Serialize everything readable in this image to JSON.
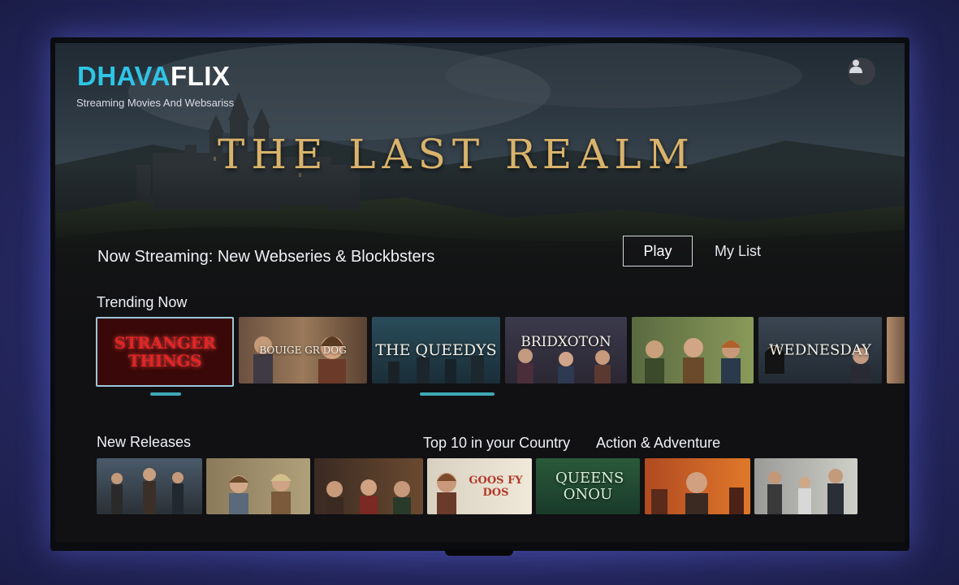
{
  "app": {
    "logo_part1": "DHAVA",
    "logo_part2": "FLIX",
    "tagline": "Streaming Movies And Websariss"
  },
  "hero": {
    "title": "THE LAST REALM",
    "subline": "Now Streaming: New Webseries & Blockbsters",
    "play_label": "Play",
    "mylist_label": "My List"
  },
  "colors": {
    "accent": "#2fc4e6",
    "title_gold": "#d9b36b",
    "indicator": "#3fa9b5"
  },
  "trending": {
    "heading": "Trending Now",
    "cards": [
      {
        "title": "STRANGER THINGS",
        "selected": true
      },
      {
        "title": "BOUIGE GR DOG",
        "selected": false
      },
      {
        "title": "THE QUEEDYS",
        "selected": false
      },
      {
        "title": "BRIDXOTON",
        "selected": false
      },
      {
        "title": "",
        "selected": false
      },
      {
        "title": "WEDNESDAY",
        "selected": false
      },
      {
        "title": "",
        "selected": false
      }
    ]
  },
  "new_releases": {
    "heading": "New Releases",
    "cards": [
      {
        "title": ""
      },
      {
        "title": ""
      },
      {
        "title": ""
      }
    ]
  },
  "top10": {
    "heading": "Top 10 in your Country",
    "cards": [
      {
        "title": "GOOS FY DOS"
      },
      {
        "title": "QUEENS ONOU"
      }
    ]
  },
  "action": {
    "heading": "Action & Adventure",
    "cards": [
      {
        "title": ""
      },
      {
        "title": ""
      }
    ]
  },
  "icons": {
    "profile": "user-profile-icon"
  }
}
